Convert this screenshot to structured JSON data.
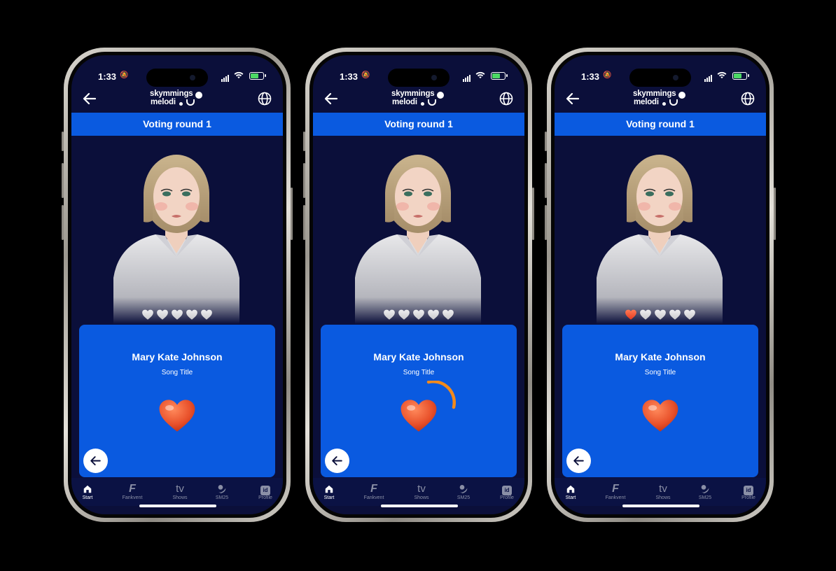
{
  "colors": {
    "accent": "#0a5ae0",
    "background": "#0b0f3a",
    "heart": "#e8502a",
    "spinner": "#f28a1c"
  },
  "phones": [
    {
      "status": {
        "time": "1:33"
      },
      "header": {
        "logo_line1": "skymmings",
        "logo_line2": "melodi"
      },
      "round_title": "Voting round 1",
      "artist": "Mary Kate Johnson",
      "song": "Song Title",
      "hearts_filled": 0,
      "loading": false,
      "tabs": [
        "Start",
        "Fankvent",
        "Shows",
        "SM25",
        "Profile"
      ]
    },
    {
      "status": {
        "time": "1:33"
      },
      "header": {
        "logo_line1": "skymmings",
        "logo_line2": "melodi"
      },
      "round_title": "Voting round 1",
      "artist": "Mary Kate Johnson",
      "song": "Song Title",
      "hearts_filled": 0,
      "loading": true,
      "tabs": [
        "Start",
        "Fankvent",
        "Shows",
        "SM25",
        "Profile"
      ]
    },
    {
      "status": {
        "time": "1:33"
      },
      "header": {
        "logo_line1": "skymmings",
        "logo_line2": "melodi"
      },
      "round_title": "Voting round 1",
      "artist": "Mary Kate Johnson",
      "song": "Song Title",
      "hearts_filled": 1,
      "loading": false,
      "tabs": [
        "Start",
        "Fankvent",
        "Shows",
        "SM25",
        "Profile"
      ]
    }
  ],
  "tab_icons": [
    "home-icon",
    "fankvent-f-icon",
    "tv-icon",
    "sm25-icon",
    "id-icon"
  ],
  "tab_icon_glyphs": [
    "",
    "F",
    "tv",
    "",
    "id"
  ]
}
